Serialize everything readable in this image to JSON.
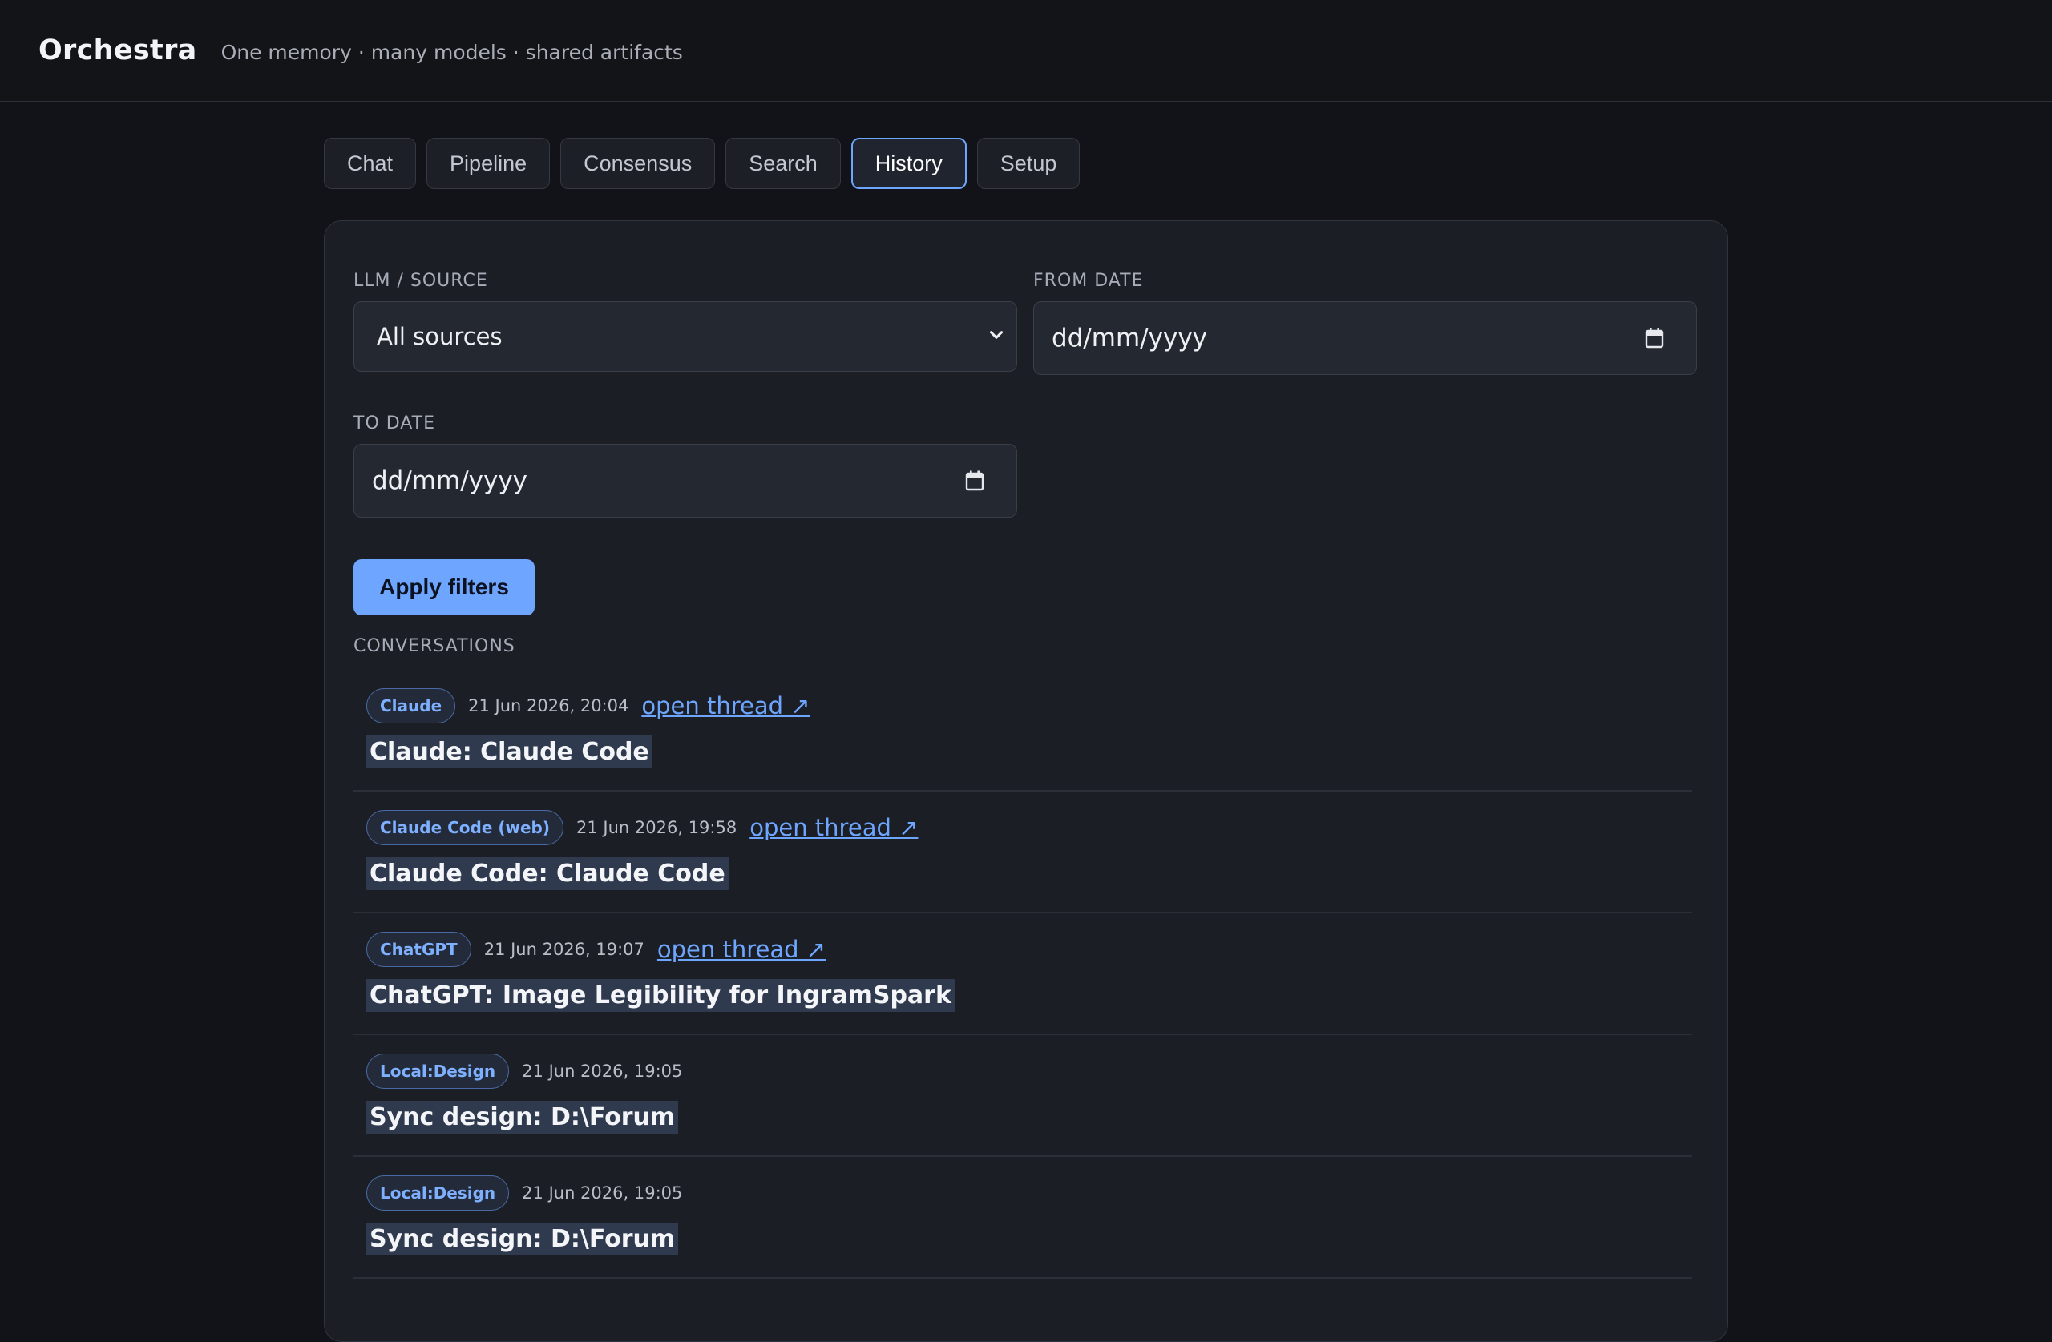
{
  "header": {
    "title": "Orchestra",
    "subtitle": "One memory · many models · shared artifacts"
  },
  "tabs": [
    {
      "label": "Chat",
      "active": false
    },
    {
      "label": "Pipeline",
      "active": false
    },
    {
      "label": "Consensus",
      "active": false
    },
    {
      "label": "Search",
      "active": false
    },
    {
      "label": "History",
      "active": true
    },
    {
      "label": "Setup",
      "active": false
    }
  ],
  "filters": {
    "source_label": "LLM / SOURCE",
    "source_value": "All sources",
    "from_label": "FROM DATE",
    "from_placeholder": "dd/mm/yyyy",
    "to_label": "TO DATE",
    "to_placeholder": "dd/mm/yyyy",
    "apply_label": "Apply filters"
  },
  "conversations": {
    "section_label": "CONVERSATIONS",
    "items": [
      {
        "badge": "Claude",
        "timestamp": "21 Jun 2026, 20:04",
        "link": "open thread ↗",
        "title": "Claude: Claude Code"
      },
      {
        "badge": "Claude Code (web)",
        "timestamp": "21 Jun 2026, 19:58",
        "link": "open thread ↗",
        "title": "Claude Code: Claude Code"
      },
      {
        "badge": "ChatGPT",
        "timestamp": "21 Jun 2026, 19:07",
        "link": "open thread ↗",
        "title": "ChatGPT: Image Legibility for IngramSpark"
      },
      {
        "badge": "Local:Design",
        "timestamp": "21 Jun 2026, 19:05",
        "link": "",
        "title": "Sync design: D:\\Forum"
      },
      {
        "badge": "Local:Design",
        "timestamp": "21 Jun 2026, 19:05",
        "link": "",
        "title": "Sync design: D:\\Forum"
      }
    ]
  },
  "colors": {
    "accent": "#6ea6ff",
    "background": "#111318",
    "panel": "#1b1e25"
  }
}
